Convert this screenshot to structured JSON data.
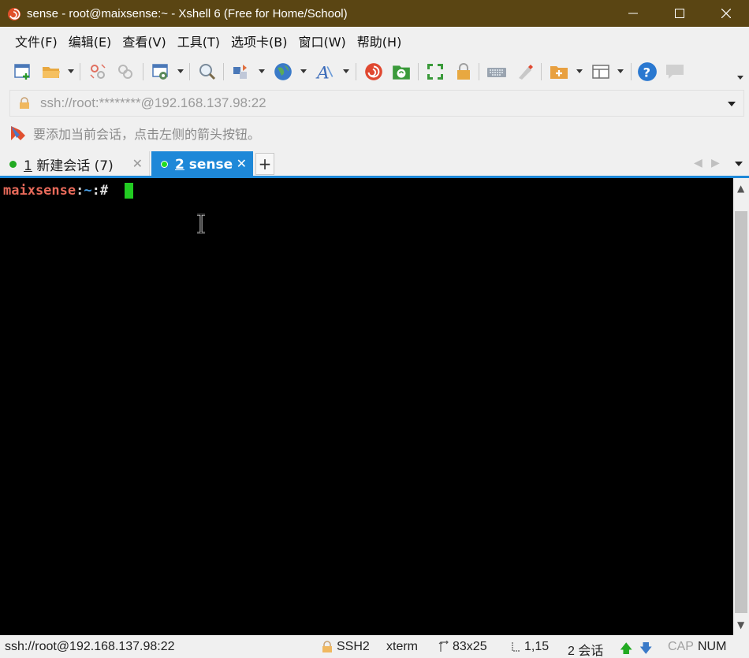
{
  "window": {
    "title": "sense - root@maixsense:~ - Xshell 6 (Free for Home/School)",
    "app_icon": "xshell-icon",
    "titlebar_color": "#5a4513"
  },
  "menu": [
    "文件(F)",
    "编辑(E)",
    "查看(V)",
    "工具(T)",
    "选项卡(B)",
    "窗口(W)",
    "帮助(H)"
  ],
  "toolbar": {
    "icons": [
      "new-session-icon",
      "open-folder-icon",
      "disconnect-icon",
      "reconnect-icon",
      "properties-icon",
      "find-icon",
      "transfer-icon",
      "globe-icon",
      "font-icon",
      "xshell-icon",
      "xftp-icon",
      "fullscreen-icon",
      "lock-icon",
      "keyboard-icon",
      "highlight-icon",
      "new-folder-icon",
      "layout-icon",
      "help-icon",
      "chat-icon"
    ]
  },
  "address": {
    "value": "ssh://root:********@192.168.137.98:22"
  },
  "hint": {
    "text": "要添加当前会话，点击左侧的箭头按钮。"
  },
  "tabs": [
    {
      "number": "1",
      "label": "新建会话 (7)",
      "status_color": "#22aa22",
      "active": false
    },
    {
      "number": "2",
      "label": "sense",
      "status_color": "#22dd22",
      "active": true
    }
  ],
  "accent_color": "#1e88d8",
  "terminal": {
    "host": "maixsense",
    "colon": ":",
    "path": "~",
    "symbol": ":#",
    "cursor_color": "#22cc22"
  },
  "status": {
    "connection": "ssh://root@192.168.137.98:22",
    "protocol": "SSH2",
    "term_type": "xterm",
    "size": "83x25",
    "position": "1,15",
    "sessions": "2 会话",
    "caps": "CAP",
    "num": "NUM"
  }
}
